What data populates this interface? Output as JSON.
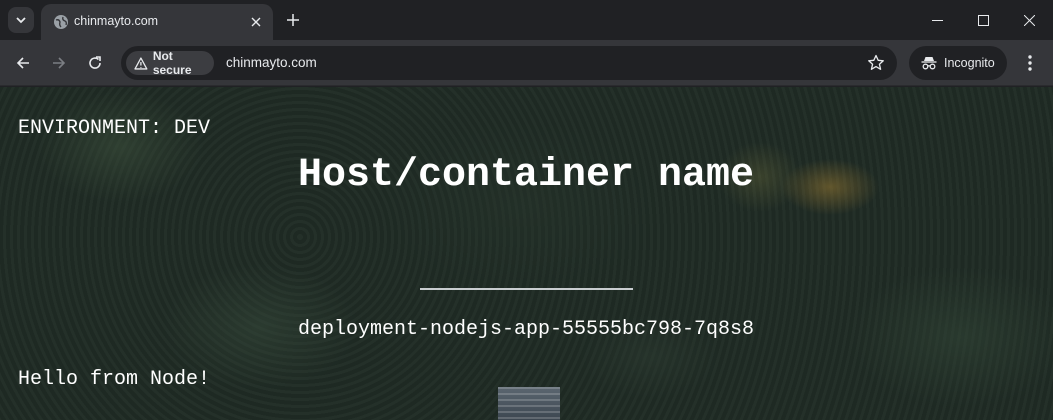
{
  "browser": {
    "tab": {
      "title": "chinmayto.com"
    },
    "address_bar": {
      "security_label": "Not secure",
      "url": "chinmayto.com"
    },
    "profile": {
      "label": "Incognito"
    },
    "icons": [
      "tab-search-icon",
      "globe-icon",
      "close-icon",
      "plus-icon",
      "minimize-icon",
      "maximize-icon",
      "window-close-icon",
      "back-arrow-icon",
      "forward-arrow-icon",
      "reload-icon",
      "warning-icon",
      "star-icon",
      "incognito-icon",
      "more-vert-icon"
    ]
  },
  "page": {
    "environment": "ENVIRONMENT: DEV",
    "heading": "Host/container name",
    "hostname": "deployment-nodejs-app-55555bc798-7q8s8",
    "message": "Hello from Node!"
  },
  "colors": {
    "chrome_dark": "#202124",
    "toolbar": "#35363a",
    "text": "#e8eaed",
    "page_text": "#ffffff",
    "divider": "#c9cdd0"
  }
}
